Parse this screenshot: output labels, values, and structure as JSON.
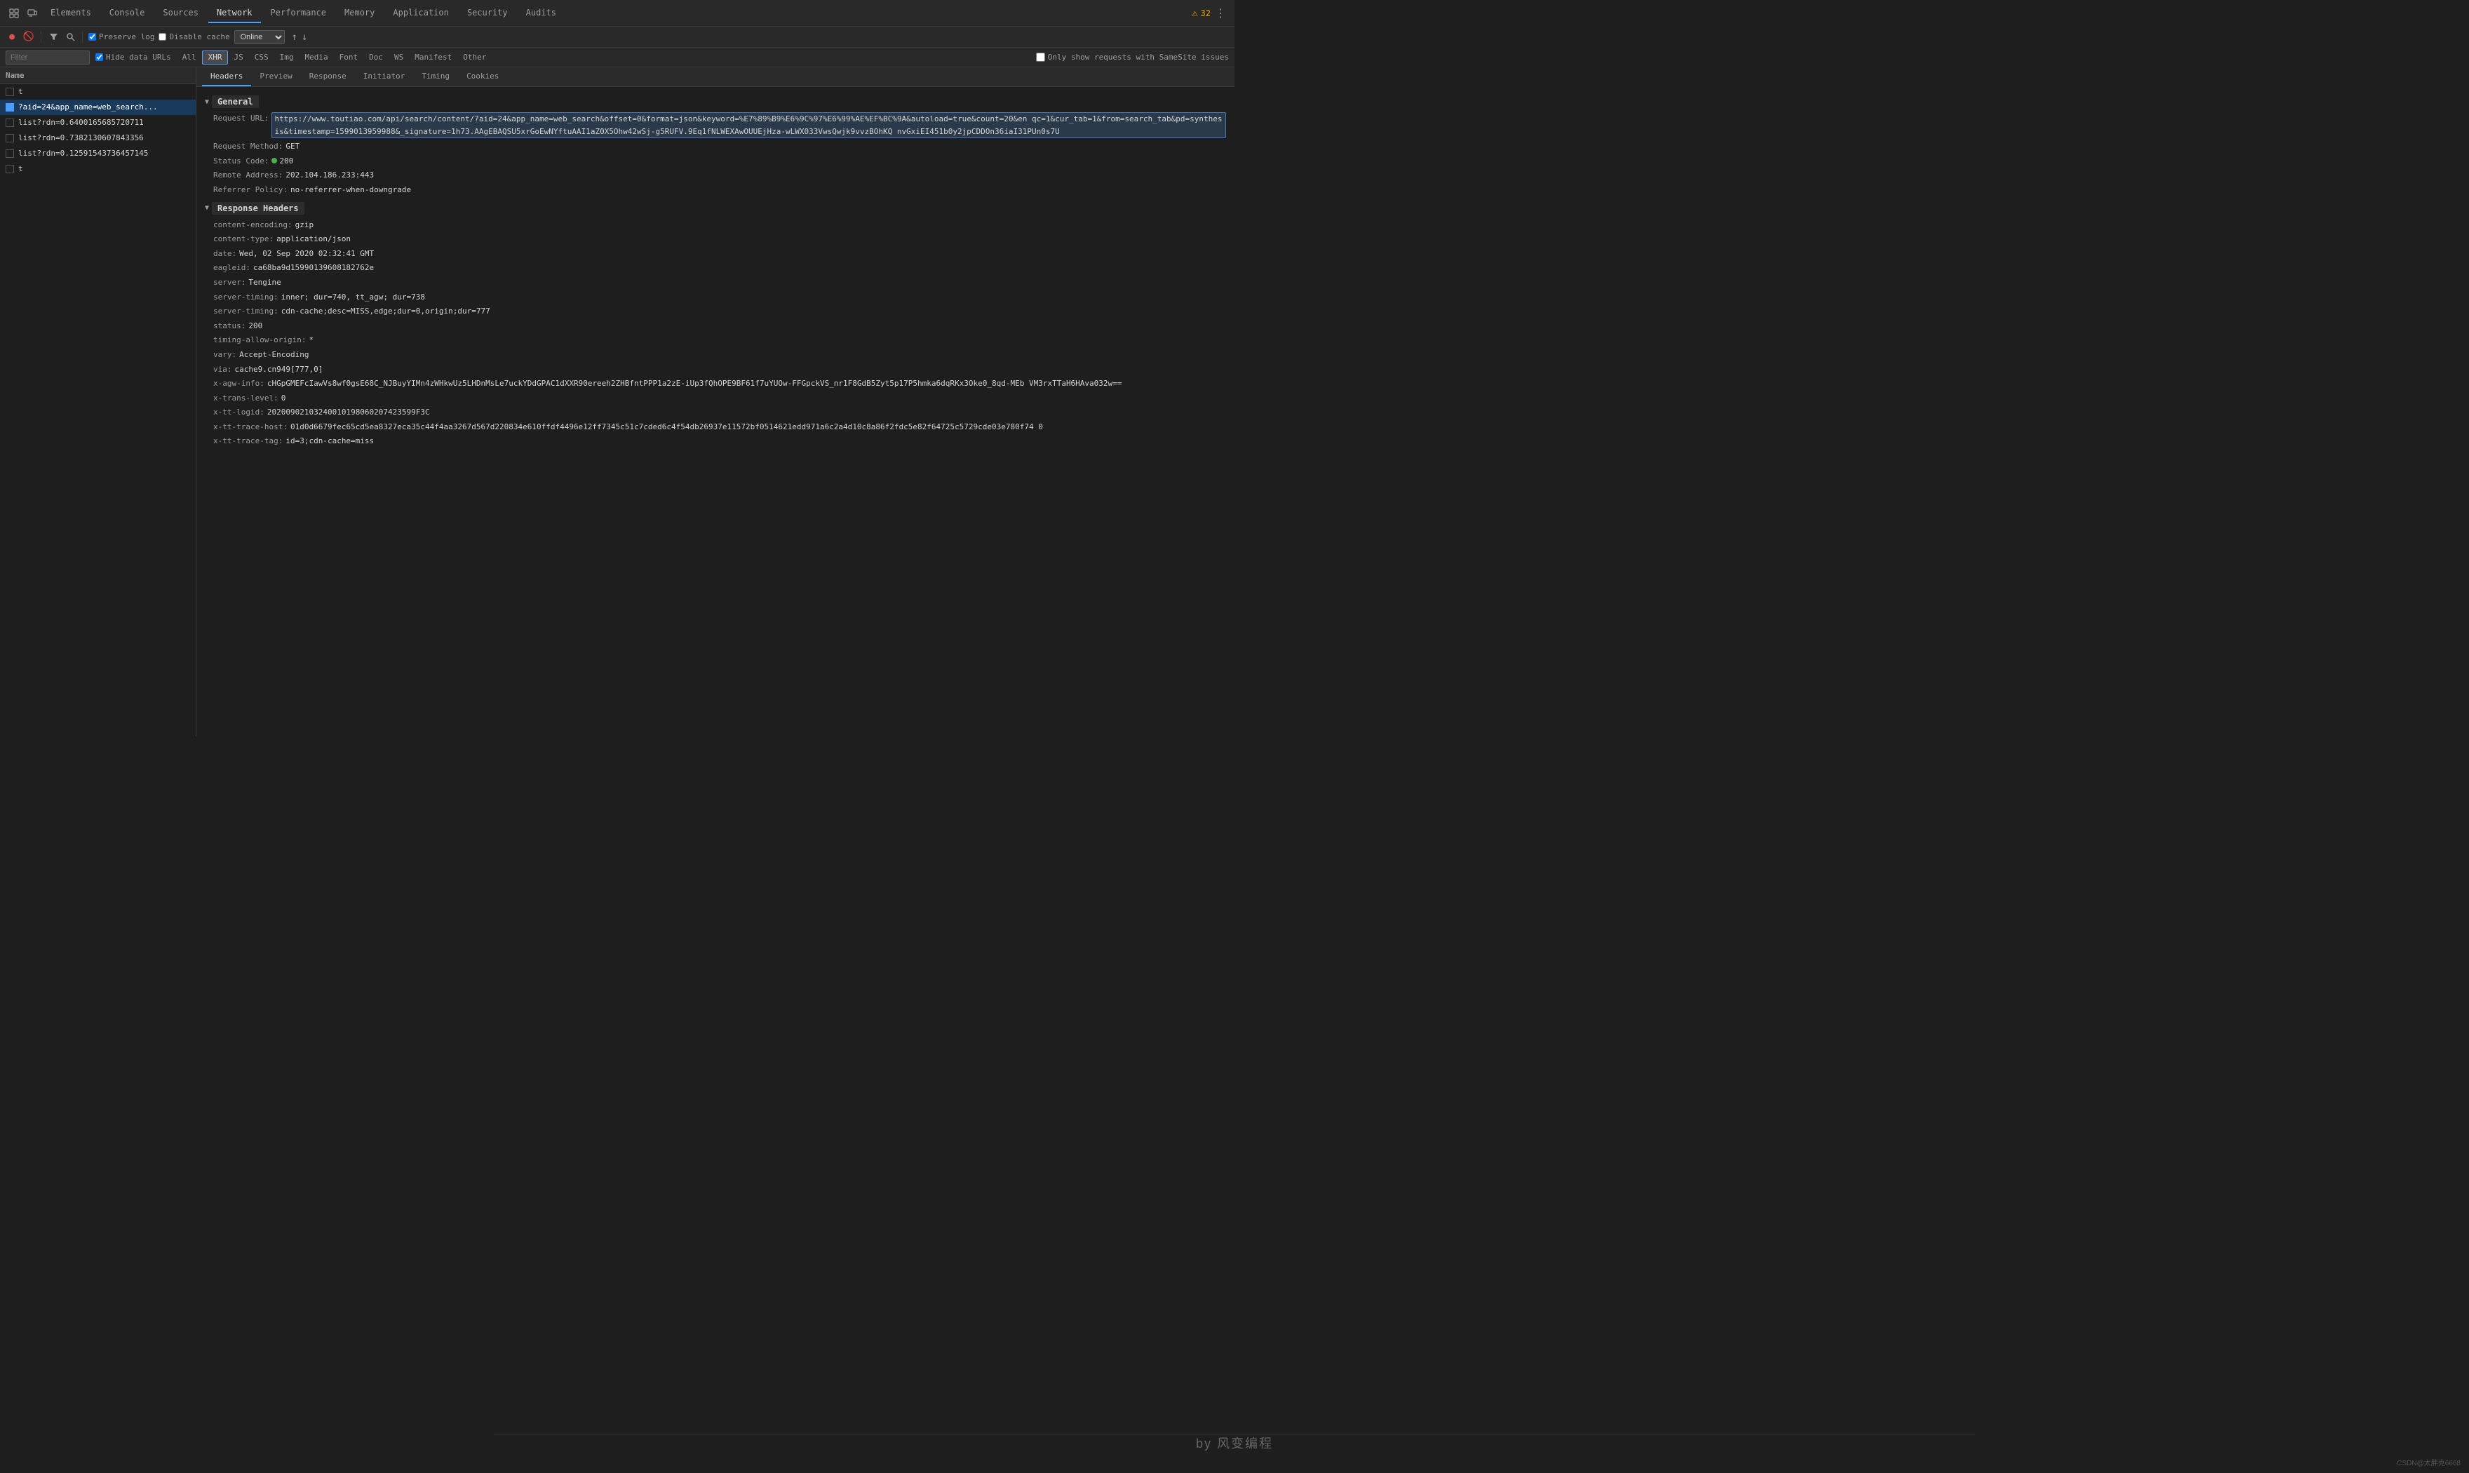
{
  "tabs": {
    "items": [
      {
        "label": "Elements",
        "active": false
      },
      {
        "label": "Console",
        "active": false
      },
      {
        "label": "Sources",
        "active": false
      },
      {
        "label": "Network",
        "active": true
      },
      {
        "label": "Performance",
        "active": false
      },
      {
        "label": "Memory",
        "active": false
      },
      {
        "label": "Application",
        "active": false
      },
      {
        "label": "Security",
        "active": false
      },
      {
        "label": "Audits",
        "active": false
      }
    ],
    "warning_count": "32"
  },
  "toolbar": {
    "preserve_log": "Preserve log",
    "disable_cache": "Disable cache",
    "online_label": "Online"
  },
  "filter_bar": {
    "placeholder": "Filter",
    "hide_data_urls": "Hide data URLs",
    "tags": [
      "All",
      "XHR",
      "JS",
      "CSS",
      "Img",
      "Media",
      "Font",
      "Doc",
      "WS",
      "Manifest",
      "Other"
    ],
    "active_tag": "XHR",
    "only_samesite": "Only show requests with SameSite issues"
  },
  "network_list": {
    "header": "Name",
    "items": [
      {
        "name": "t",
        "selected": false
      },
      {
        "name": "?aid=24&app_name=web_search...",
        "selected": true
      },
      {
        "name": "list?rdn=0.6400165685720711",
        "selected": false
      },
      {
        "name": "list?rdn=0.7382130607843356",
        "selected": false
      },
      {
        "name": "list?rdn=0.12591543736457145",
        "selected": false
      },
      {
        "name": "t",
        "selected": false
      }
    ]
  },
  "panel_tabs": {
    "items": [
      "Headers",
      "Preview",
      "Response",
      "Initiator",
      "Timing",
      "Cookies"
    ],
    "active": "Headers"
  },
  "headers": {
    "general": {
      "section_label": "General",
      "request_url_label": "Request URL:",
      "request_url_value": "https://www.toutiao.com/api/search/content/?aid=24&app_name=web_search&offset=0&format=json&keyword=%E7%89%B9%E6%9C%97%E6%99%AE%EF%BC%9A&autoload=true&count=20&en",
      "request_url_suffix": "qc=1&cur_tab=1&from=search_tab&pd=synthesis&timestamp=1599013959988&_signature=1h73.AAgEBAQSU5xrGoEwNYftuAAI1aZ0X5Ohw42wSj-g5RUFV.9Eq1fNLWEXAwOUUEjHza-wLWX033VwsQwjk9vvzBOhKQ nvGxiEI451b0y2jpCDDOn36iaI31PUn0s7U",
      "request_method_label": "Request Method:",
      "request_method_value": "GET",
      "status_code_label": "Status Code:",
      "status_code_value": "200",
      "remote_address_label": "Remote Address:",
      "remote_address_value": "202.104.186.233:443",
      "referrer_policy_label": "Referrer Policy:",
      "referrer_policy_value": "no-referrer-when-downgrade"
    },
    "response_headers": {
      "section_label": "Response Headers",
      "items": [
        {
          "key": "content-encoding:",
          "value": "gzip"
        },
        {
          "key": "content-type:",
          "value": "application/json"
        },
        {
          "key": "date:",
          "value": "Wed, 02 Sep 2020 02:32:41 GMT"
        },
        {
          "key": "eagleid:",
          "value": "ca68ba9d15990139608182762e"
        },
        {
          "key": "server:",
          "value": "Tengine"
        },
        {
          "key": "server-timing:",
          "value": "inner; dur=740, tt_agw; dur=738"
        },
        {
          "key": "server-timing:",
          "value": "cdn-cache;desc=MISS,edge;dur=0,origin;dur=777"
        },
        {
          "key": "status:",
          "value": "200"
        },
        {
          "key": "timing-allow-origin:",
          "value": "*"
        },
        {
          "key": "vary:",
          "value": "Accept-Encoding"
        },
        {
          "key": "via:",
          "value": "cache9.cn949[777,0]"
        },
        {
          "key": "x-agw-info:",
          "value": "cHGpGMEFcIawVs8wf0gsE68C_NJBuyYIMn4zWHkwUz5LHDnMsLe7uckYDdGPAC1dXXR90ereeh2ZHBfntPPP1a2zE-iUp3fQhOPE9BF61f7uYUOw-FFGpckVS_nr1F8GdB5Zyt5p17P5hmka6dqRKx3Oke0_8qd-MEb VM3rxTTaH6HAva032w=="
        },
        {
          "key": "x-trans-level:",
          "value": "0"
        },
        {
          "key": "x-tt-logid:",
          "value": "20200902103240010198060207423599F3C"
        },
        {
          "key": "x-tt-trace-host:",
          "value": "01d0d6679fec65cd5ea8327eca35c44f4aa3267d567d220834e610ffdf4496e12ff7345c51c7cded6c4f54db26937e11572bf0514621edd971a6c2a4d10c8a86f2fdc5e82f64725c5729cde03e780f74 0"
        },
        {
          "key": "x-tt-trace-tag:",
          "value": "id=3;cdn-cache=miss"
        }
      ]
    }
  },
  "watermark": {
    "text": "by 风变编程"
  },
  "branding": {
    "text": "CSDN@太胖克6668"
  }
}
